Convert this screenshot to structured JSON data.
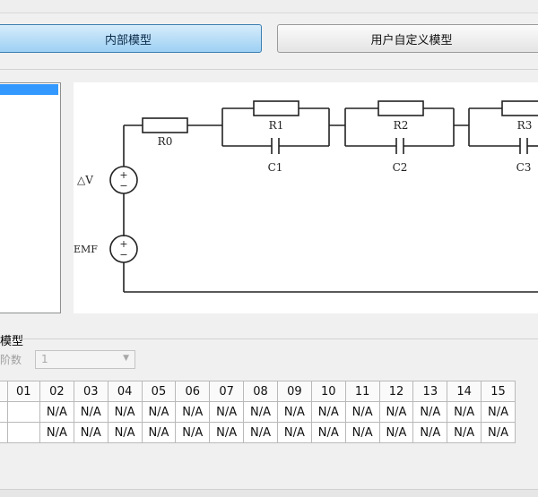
{
  "tabs": {
    "internal_label": "内部模型",
    "custom_label": "用户自定义模型"
  },
  "diagram": {
    "labels": {
      "r0": "R0",
      "r1": "R1",
      "r2": "R2",
      "r3": "R3",
      "c1": "C1",
      "c2": "C2",
      "c3": "C3",
      "dv": "△V",
      "emf": "EMF",
      "plus": "+",
      "minus": "−"
    }
  },
  "section": {
    "title": "模型",
    "count_label": "阶数",
    "count_value": "1"
  },
  "table": {
    "headers": [
      "01",
      "02",
      "03",
      "04",
      "05",
      "06",
      "07",
      "08",
      "09",
      "10",
      "11",
      "12",
      "13",
      "14",
      "15"
    ],
    "rows": [
      [
        "",
        "N/A",
        "N/A",
        "N/A",
        "N/A",
        "N/A",
        "N/A",
        "N/A",
        "N/A",
        "N/A",
        "N/A",
        "N/A",
        "N/A",
        "N/A",
        "N/A"
      ],
      [
        "",
        "N/A",
        "N/A",
        "N/A",
        "N/A",
        "N/A",
        "N/A",
        "N/A",
        "N/A",
        "N/A",
        "N/A",
        "N/A",
        "N/A",
        "N/A",
        "N/A"
      ]
    ]
  }
}
